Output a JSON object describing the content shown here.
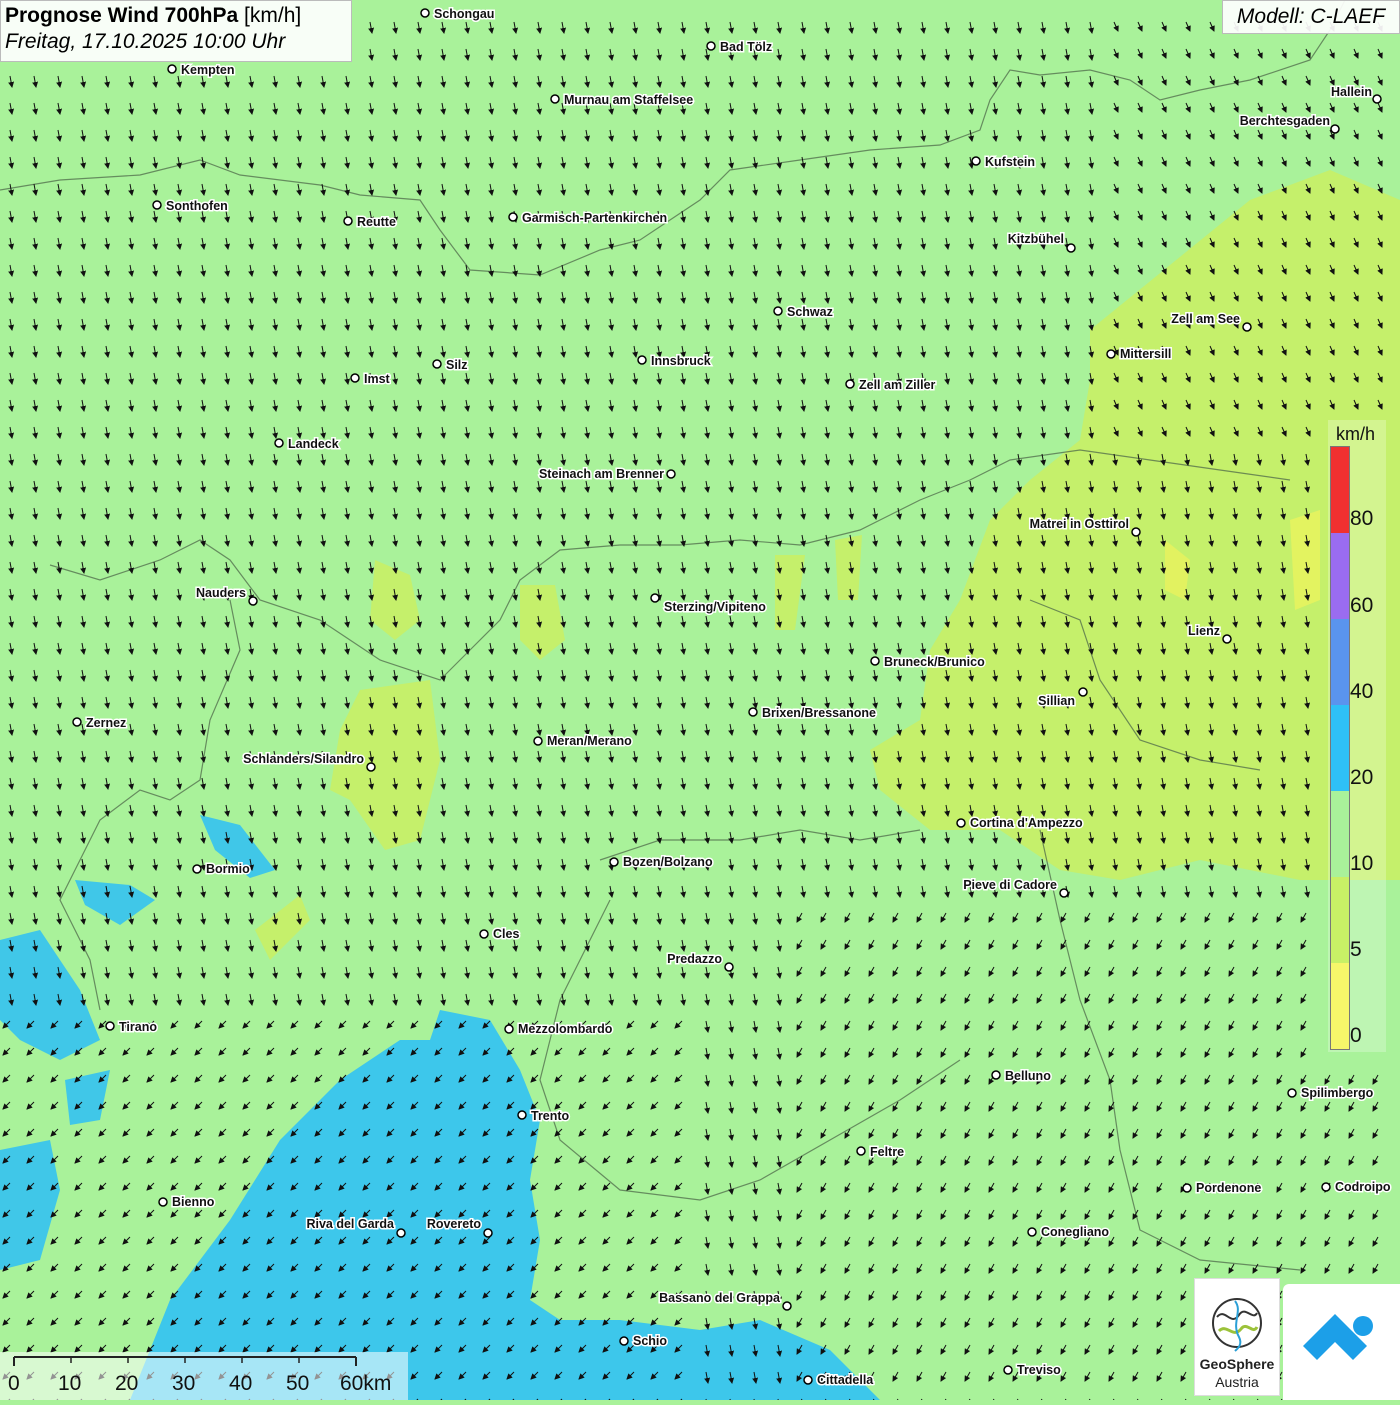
{
  "title": {
    "main": "Prognose Wind 700hPa",
    "unit": "[km/h]",
    "datetime": "Freitag, 17.10.2025 10:00 Uhr"
  },
  "model": "Modell: C-LAEF",
  "legend": {
    "unit": "km/h",
    "ticks": [
      "80",
      "60",
      "40",
      "20",
      "10",
      "5",
      "0"
    ],
    "colors": [
      "#f03030",
      "#9a6cf0",
      "#5a94ee",
      "#2ec0f6",
      "#a9f29a",
      "#c8f066",
      "#f6f66a"
    ]
  },
  "scale": {
    "labels": [
      "0",
      "10",
      "20",
      "30",
      "40",
      "50",
      "60km"
    ]
  },
  "logo": {
    "line1": "GeoSphere",
    "line2": "Austria"
  },
  "cities": [
    {
      "name": "Schongau"
    },
    {
      "name": "Bad Tölz"
    },
    {
      "name": "Kempten"
    },
    {
      "name": "Murnau am Staffelsee"
    },
    {
      "name": "Hallein"
    },
    {
      "name": "Berchtesgaden"
    },
    {
      "name": "Kufstein"
    },
    {
      "name": "Sonthofen"
    },
    {
      "name": "Reutte"
    },
    {
      "name": "Garmisch-Partenkirchen"
    },
    {
      "name": "Kitzbühel"
    },
    {
      "name": "Schwaz"
    },
    {
      "name": "Zell am See"
    },
    {
      "name": "Mittersill"
    },
    {
      "name": "Silz"
    },
    {
      "name": "Innsbruck"
    },
    {
      "name": "Imst"
    },
    {
      "name": "Zell am Ziller"
    },
    {
      "name": "Landeck"
    },
    {
      "name": "Steinach am Brenner"
    },
    {
      "name": "Matrei in Osttirol"
    },
    {
      "name": "Nauders"
    },
    {
      "name": "Sterzing/Vipiteno"
    },
    {
      "name": "Lienz"
    },
    {
      "name": "Bruneck/Brunico"
    },
    {
      "name": "Sillian"
    },
    {
      "name": "Zernez"
    },
    {
      "name": "Brixen/Bressanone"
    },
    {
      "name": "Meran/Merano"
    },
    {
      "name": "Schlanders/Silandro"
    },
    {
      "name": "Cortina d'Ampezzo"
    },
    {
      "name": "Bozen/Bolzano"
    },
    {
      "name": "Bormio"
    },
    {
      "name": "Pieve di Cadore"
    },
    {
      "name": "Cles"
    },
    {
      "name": "Predazzo"
    },
    {
      "name": "Tirano"
    },
    {
      "name": "Mezzolombardo"
    },
    {
      "name": "Belluno"
    },
    {
      "name": "Spilimbergo"
    },
    {
      "name": "Trento"
    },
    {
      "name": "Feltre"
    },
    {
      "name": "Bienno"
    },
    {
      "name": "Pordenone"
    },
    {
      "name": "Codroipo"
    },
    {
      "name": "Riva del Garda"
    },
    {
      "name": "Rovereto"
    },
    {
      "name": "Conegliano"
    },
    {
      "name": "Bassano del Grappa"
    },
    {
      "name": "Schio"
    },
    {
      "name": "Treviso"
    },
    {
      "name": "Cittadella"
    }
  ]
}
